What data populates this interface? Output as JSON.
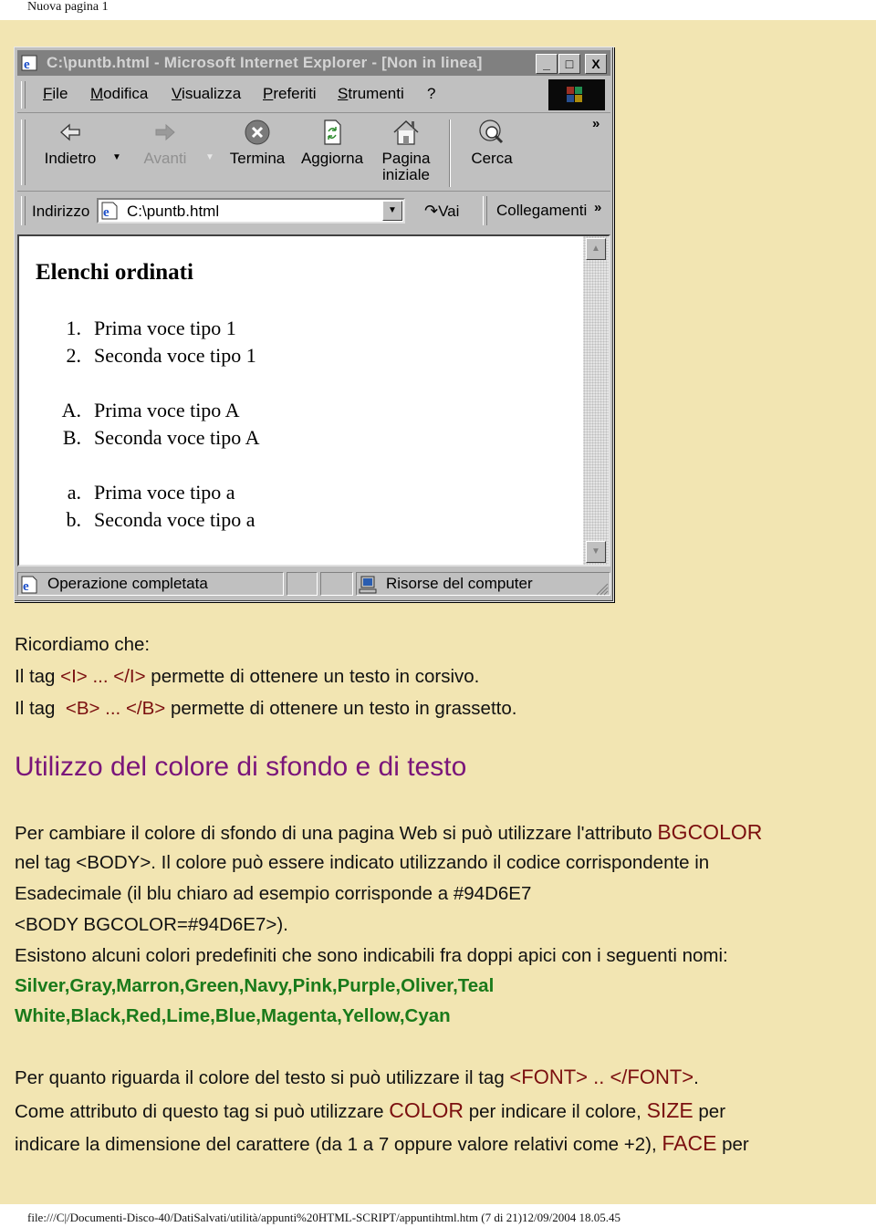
{
  "pdf_header": {
    "title": "Nuova pagina 1"
  },
  "browser": {
    "title_bar": {
      "title": "C:\\puntb.html - Microsoft Internet Explorer - [Non in linea]",
      "buttons": {
        "minimize": "_",
        "maximize": "□",
        "close": "X"
      }
    },
    "menu": [
      "File",
      "Modifica",
      "Visualizza",
      "Preferiti",
      "Strumenti",
      "?"
    ],
    "toolbar": {
      "back": "Indietro",
      "forward": "Avanti",
      "stop": "Termina",
      "refresh": "Aggiorna",
      "home_line1": "Pagina",
      "home_line2": "iniziale",
      "search": "Cerca",
      "more": "»"
    },
    "address_bar": {
      "label": "Indirizzo",
      "value": "C:\\puntb.html",
      "go": "Vai",
      "links": "Collegamenti",
      "more": "»"
    },
    "page": {
      "heading": "Elenchi ordinati",
      "lists": [
        {
          "type": "1",
          "items": [
            {
              "marker": "1.",
              "text": "Prima voce tipo 1"
            },
            {
              "marker": "2.",
              "text": "Seconda voce tipo 1"
            }
          ]
        },
        {
          "type": "A",
          "items": [
            {
              "marker": "A.",
              "text": "Prima voce tipo A"
            },
            {
              "marker": "B.",
              "text": "Seconda voce tipo A"
            }
          ]
        },
        {
          "type": "a",
          "items": [
            {
              "marker": "a.",
              "text": "Prima voce tipo a"
            },
            {
              "marker": "b.",
              "text": "Seconda voce tipo a"
            }
          ]
        }
      ]
    },
    "status_bar": {
      "status": "Operazione completata",
      "zone": "Risorse del computer"
    }
  },
  "doc": {
    "remember": "Ricordiamo che:",
    "italic_line": {
      "pre": "Il tag ",
      "tag": "<I> ... </I>",
      "post": " permette di ottenere un testo in corsivo."
    },
    "bold_line": {
      "pre": "Il tag  ",
      "tag": "<B> ... </B>",
      "post": " permette di ottenere un testo in grassetto."
    },
    "section_title": "Utilizzo del colore di sfondo e di testo",
    "para1": {
      "line1_pre": "Per cambiare il colore di sfondo di una pagina Web si può utilizzare l'attributo ",
      "line1_attr": "BGCOLOR",
      "line2": "nel tag <BODY>. Il colore può essere indicato utilizzando il codice corrispondente in",
      "line3": "Esadecimale (il blu chiaro ad esempio corrisponde a #94D6E7",
      "line4": "<BODY BGCOLOR=#94D6E7>)."
    },
    "para2": {
      "intro": "Esistono alcuni colori predefiniti che sono indicabili fra doppi apici con i seguenti nomi:",
      "colors_line1": "Silver,Gray,Marron,Green,Navy,Pink,Purple,Oliver,Teal",
      "colors_line2": "White,Black,Red,Lime,Blue,Magenta,Yellow,Cyan"
    },
    "para3": {
      "line1_pre": "Per quanto riguarda il colore del testo si può utilizzare il tag ",
      "line1_tag": "<FONT> .. </FONT>",
      "line1_post": ".",
      "line2_pre": "Come attributo di questo tag si può utilizzare ",
      "line2_attr1": "COLOR",
      "line2_mid": " per indicare il colore, ",
      "line2_attr2": "SIZE",
      "line2_post": " per",
      "line3_pre": "indicare la dimensione del carattere (da 1 a 7 oppure valore relativi come +2), ",
      "line3_attr": "FACE",
      "line3_post": " per"
    },
    "colors": {
      "background": "#f2e5b2",
      "tag_red": "#7b0f0f",
      "heading_purple": "#7a157a",
      "color_names_green": "#1a7a1a"
    }
  },
  "pdf_footer": {
    "text": "file:///C|/Documenti-Disco-40/DatiSalvati/utilità/appunti%20HTML-SCRIPT/appuntihtml.htm (7 di 21)12/09/2004 18.05.45"
  }
}
